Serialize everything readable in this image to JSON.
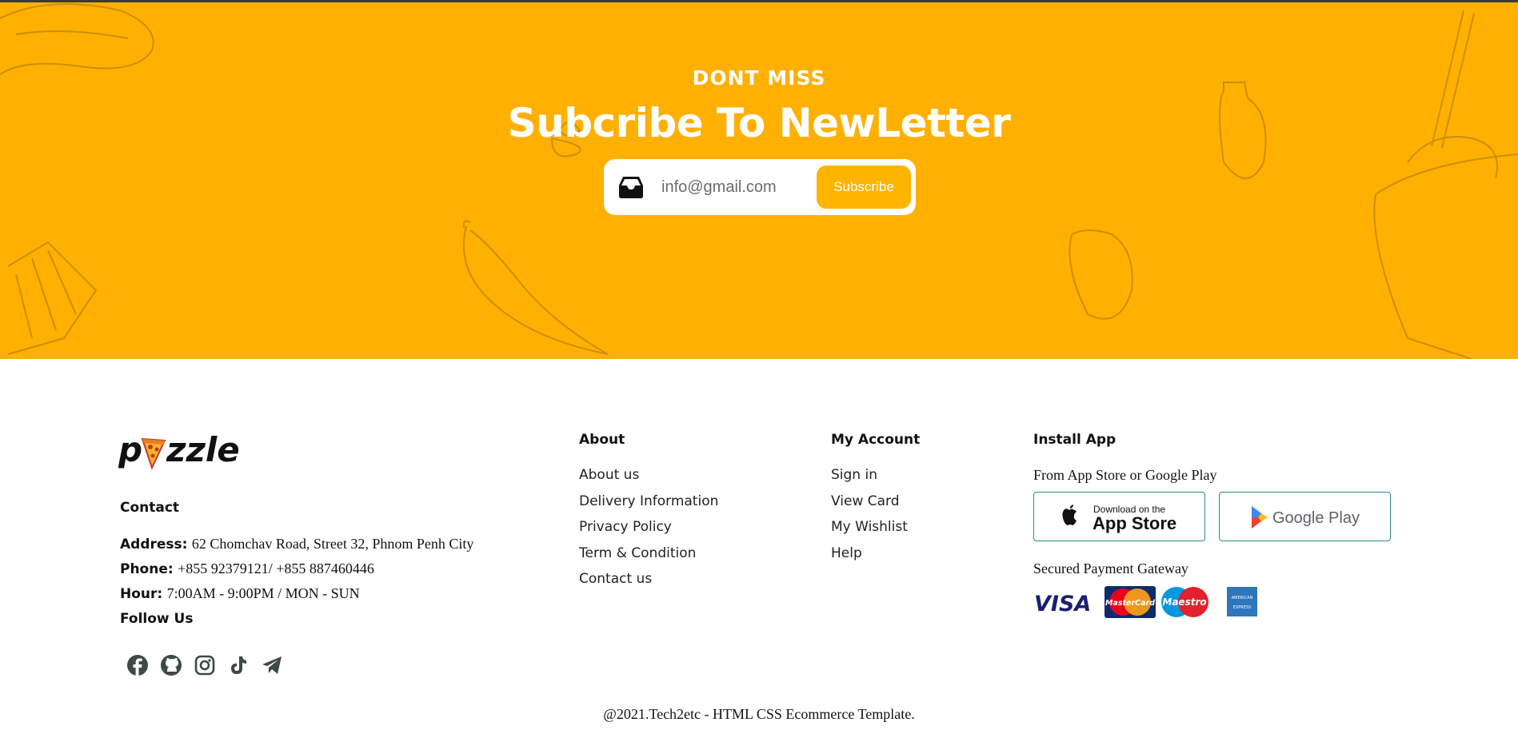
{
  "newsletter": {
    "eyebrow": "DONT MISS",
    "headline": "Subcribe To NewLetter",
    "email_placeholder": "info@gmail.com",
    "subscribe_label": "Subscribe",
    "background_color": "#ffb000"
  },
  "brand": {
    "logo_text_left": "p",
    "logo_text_right": "zzle",
    "logo_icon": "pizza-slice-icon"
  },
  "contact": {
    "title": "Contact",
    "address_label": "Address:",
    "address_value": "62 Chomchav Road, Street 32, Phnom Penh City",
    "phone_label": "Phone:",
    "phone_value": "+855 92379121/ +855 887460446",
    "hour_label": "Hour:",
    "hour_value": "7:00AM - 9:00PM / MON - SUN",
    "follow_title": "Follow Us",
    "social_icons": [
      "facebook-icon",
      "github-icon",
      "instagram-icon",
      "tiktok-icon",
      "telegram-icon"
    ]
  },
  "about": {
    "title": "About",
    "links": [
      "About us",
      "Delivery Information",
      "Privacy Policy",
      "Term & Condition",
      "Contact us"
    ]
  },
  "account": {
    "title": "My Account",
    "links": [
      "Sign in",
      "View Card",
      "My Wishlist",
      "Help"
    ]
  },
  "install": {
    "title": "Install App",
    "subtitle": "From App Store or Google Play",
    "app_store_small": "Download on the",
    "app_store_big": "App Store",
    "google_play": "Google Play",
    "payment_title": "Secured Payment Gateway",
    "payment_icons": [
      "visa-icon",
      "mastercard-icon",
      "maestro-icon",
      "amex-icon"
    ],
    "visa_text": "VISA",
    "mastercard_text": "MasterCard",
    "maestro_text": "Maestro",
    "amex_text": "AMERICAN EXPRESS"
  },
  "footer": {
    "copyright": "@2021.Tech2etc - HTML CSS Ecommerce Template."
  },
  "colors": {
    "accent": "#ffb000",
    "button": "#ffb400",
    "icon_dark": "#3d4a45",
    "store_border": "#2b8a8a"
  }
}
